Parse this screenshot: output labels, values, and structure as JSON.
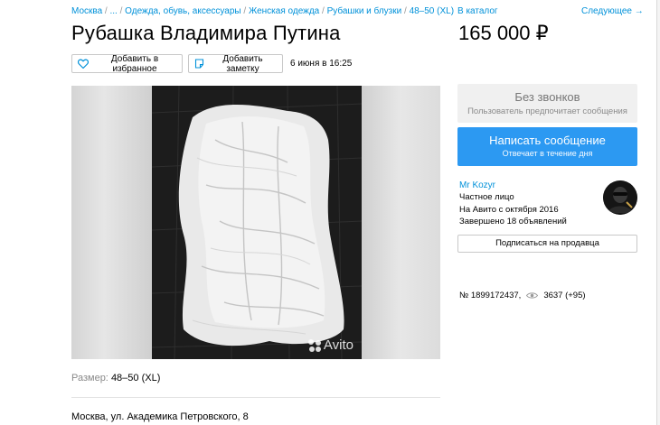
{
  "breadcrumb": {
    "items": [
      "Москва",
      "...",
      "Одежда, обувь, аксессуары",
      "Женская одежда",
      "Рубашки и блузки",
      "48–50 (XL)"
    ],
    "separator": " / "
  },
  "nav": {
    "catalog": "В каталог",
    "next": "Следующее →"
  },
  "listing": {
    "title": "Рубашка Владимира Путина",
    "price": "165 000 ₽",
    "favorite_label": "Добавить в избранное",
    "note_label": "Добавить заметку",
    "date": "6 июня в 16:25",
    "watermark": "Avito",
    "size_label": "Размер:",
    "size_value": "48–50 (XL)",
    "address": "Москва, ул. Академика Петровского, 8"
  },
  "contact": {
    "no_calls_title": "Без звонков",
    "no_calls_sub": "Пользователь предпочитает сообщения",
    "message_title": "Написать сообщение",
    "message_sub": "Отвечает в течение дня"
  },
  "seller": {
    "name": "Mr Kozyr",
    "type": "Частное лицо",
    "since": "На Авито с октября 2016",
    "completed": "Завершено 18 объявлений",
    "subscribe": "Подписаться на продавца"
  },
  "stats": {
    "item_number": "№ 1899172437,",
    "views": "3637 (+95)"
  },
  "colors": {
    "link": "#0091d9",
    "primary_button": "#2c99f2",
    "muted_panel": "#f0f0f0"
  }
}
